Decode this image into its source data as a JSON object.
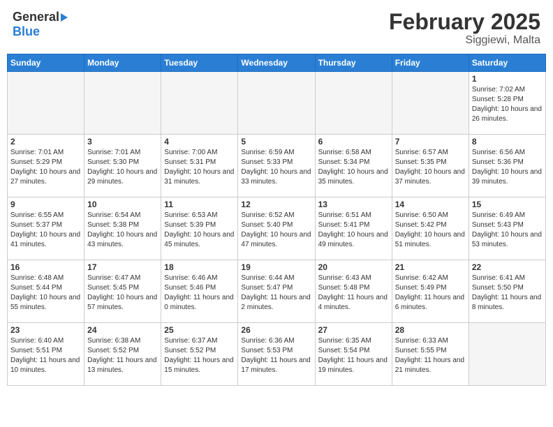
{
  "header": {
    "logo_general": "General",
    "logo_blue": "Blue",
    "title": "February 2025",
    "subtitle": "Siggiewi, Malta"
  },
  "days_header": [
    "Sunday",
    "Monday",
    "Tuesday",
    "Wednesday",
    "Thursday",
    "Friday",
    "Saturday"
  ],
  "weeks": [
    [
      {
        "num": "",
        "info": ""
      },
      {
        "num": "",
        "info": ""
      },
      {
        "num": "",
        "info": ""
      },
      {
        "num": "",
        "info": ""
      },
      {
        "num": "",
        "info": ""
      },
      {
        "num": "",
        "info": ""
      },
      {
        "num": "1",
        "info": "Sunrise: 7:02 AM\nSunset: 5:28 PM\nDaylight: 10 hours and 26 minutes."
      }
    ],
    [
      {
        "num": "2",
        "info": "Sunrise: 7:01 AM\nSunset: 5:29 PM\nDaylight: 10 hours and 27 minutes."
      },
      {
        "num": "3",
        "info": "Sunrise: 7:01 AM\nSunset: 5:30 PM\nDaylight: 10 hours and 29 minutes."
      },
      {
        "num": "4",
        "info": "Sunrise: 7:00 AM\nSunset: 5:31 PM\nDaylight: 10 hours and 31 minutes."
      },
      {
        "num": "5",
        "info": "Sunrise: 6:59 AM\nSunset: 5:33 PM\nDaylight: 10 hours and 33 minutes."
      },
      {
        "num": "6",
        "info": "Sunrise: 6:58 AM\nSunset: 5:34 PM\nDaylight: 10 hours and 35 minutes."
      },
      {
        "num": "7",
        "info": "Sunrise: 6:57 AM\nSunset: 5:35 PM\nDaylight: 10 hours and 37 minutes."
      },
      {
        "num": "8",
        "info": "Sunrise: 6:56 AM\nSunset: 5:36 PM\nDaylight: 10 hours and 39 minutes."
      }
    ],
    [
      {
        "num": "9",
        "info": "Sunrise: 6:55 AM\nSunset: 5:37 PM\nDaylight: 10 hours and 41 minutes."
      },
      {
        "num": "10",
        "info": "Sunrise: 6:54 AM\nSunset: 5:38 PM\nDaylight: 10 hours and 43 minutes."
      },
      {
        "num": "11",
        "info": "Sunrise: 6:53 AM\nSunset: 5:39 PM\nDaylight: 10 hours and 45 minutes."
      },
      {
        "num": "12",
        "info": "Sunrise: 6:52 AM\nSunset: 5:40 PM\nDaylight: 10 hours and 47 minutes."
      },
      {
        "num": "13",
        "info": "Sunrise: 6:51 AM\nSunset: 5:41 PM\nDaylight: 10 hours and 49 minutes."
      },
      {
        "num": "14",
        "info": "Sunrise: 6:50 AM\nSunset: 5:42 PM\nDaylight: 10 hours and 51 minutes."
      },
      {
        "num": "15",
        "info": "Sunrise: 6:49 AM\nSunset: 5:43 PM\nDaylight: 10 hours and 53 minutes."
      }
    ],
    [
      {
        "num": "16",
        "info": "Sunrise: 6:48 AM\nSunset: 5:44 PM\nDaylight: 10 hours and 55 minutes."
      },
      {
        "num": "17",
        "info": "Sunrise: 6:47 AM\nSunset: 5:45 PM\nDaylight: 10 hours and 57 minutes."
      },
      {
        "num": "18",
        "info": "Sunrise: 6:46 AM\nSunset: 5:46 PM\nDaylight: 11 hours and 0 minutes."
      },
      {
        "num": "19",
        "info": "Sunrise: 6:44 AM\nSunset: 5:47 PM\nDaylight: 11 hours and 2 minutes."
      },
      {
        "num": "20",
        "info": "Sunrise: 6:43 AM\nSunset: 5:48 PM\nDaylight: 11 hours and 4 minutes."
      },
      {
        "num": "21",
        "info": "Sunrise: 6:42 AM\nSunset: 5:49 PM\nDaylight: 11 hours and 6 minutes."
      },
      {
        "num": "22",
        "info": "Sunrise: 6:41 AM\nSunset: 5:50 PM\nDaylight: 11 hours and 8 minutes."
      }
    ],
    [
      {
        "num": "23",
        "info": "Sunrise: 6:40 AM\nSunset: 5:51 PM\nDaylight: 11 hours and 10 minutes."
      },
      {
        "num": "24",
        "info": "Sunrise: 6:38 AM\nSunset: 5:52 PM\nDaylight: 11 hours and 13 minutes."
      },
      {
        "num": "25",
        "info": "Sunrise: 6:37 AM\nSunset: 5:52 PM\nDaylight: 11 hours and 15 minutes."
      },
      {
        "num": "26",
        "info": "Sunrise: 6:36 AM\nSunset: 5:53 PM\nDaylight: 11 hours and 17 minutes."
      },
      {
        "num": "27",
        "info": "Sunrise: 6:35 AM\nSunset: 5:54 PM\nDaylight: 11 hours and 19 minutes."
      },
      {
        "num": "28",
        "info": "Sunrise: 6:33 AM\nSunset: 5:55 PM\nDaylight: 11 hours and 21 minutes."
      },
      {
        "num": "",
        "info": ""
      }
    ]
  ]
}
